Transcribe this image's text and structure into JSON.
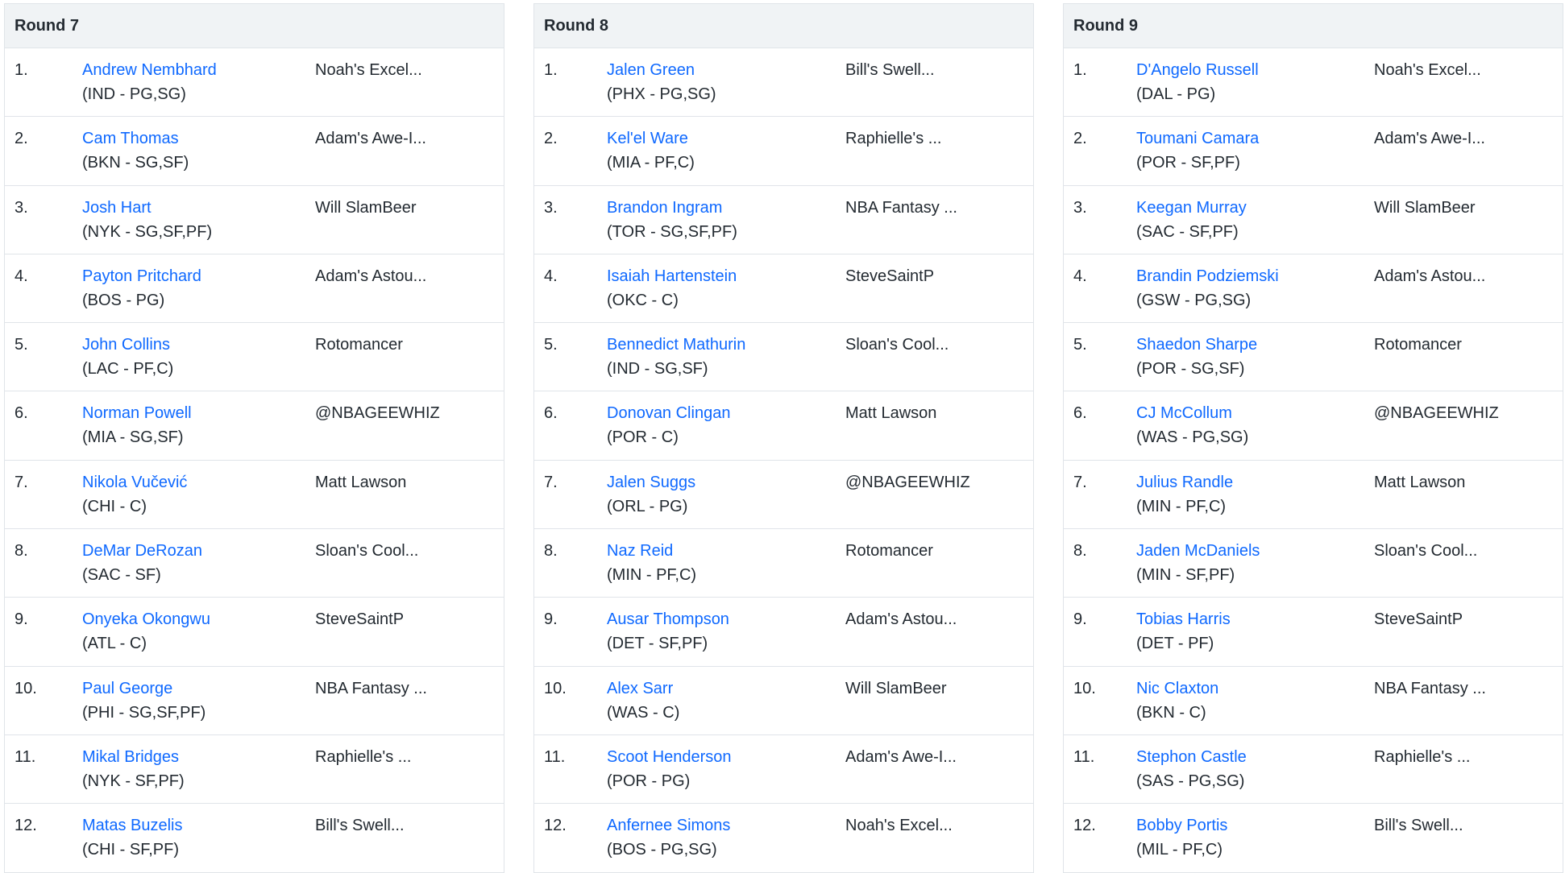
{
  "rounds": [
    {
      "title": "Round 7",
      "picks": [
        {
          "num": "1.",
          "player": "Andrew Nembhard",
          "meta": "(IND - PG,SG)",
          "team": "Noah's Excel..."
        },
        {
          "num": "2.",
          "player": "Cam Thomas",
          "meta": "(BKN - SG,SF)",
          "team": "Adam's Awe-I..."
        },
        {
          "num": "3.",
          "player": "Josh Hart",
          "meta": "(NYK - SG,SF,PF)",
          "team": "Will SlamBeer"
        },
        {
          "num": "4.",
          "player": "Payton Pritchard",
          "meta": "(BOS - PG)",
          "team": "Adam's Astou..."
        },
        {
          "num": "5.",
          "player": "John Collins",
          "meta": "(LAC - PF,C)",
          "team": "Rotomancer"
        },
        {
          "num": "6.",
          "player": "Norman Powell",
          "meta": "(MIA - SG,SF)",
          "team": "@NBAGEEWHIZ"
        },
        {
          "num": "7.",
          "player": "Nikola Vučević",
          "meta": "(CHI - C)",
          "team": "Matt Lawson"
        },
        {
          "num": "8.",
          "player": "DeMar DeRozan",
          "meta": "(SAC - SF)",
          "team": "Sloan's Cool..."
        },
        {
          "num": "9.",
          "player": "Onyeka Okongwu",
          "meta": "(ATL - C)",
          "team": "SteveSaintP"
        },
        {
          "num": "10.",
          "player": "Paul George",
          "meta": "(PHI - SG,SF,PF)",
          "team": "NBA Fantasy ..."
        },
        {
          "num": "11.",
          "player": "Mikal Bridges",
          "meta": "(NYK - SF,PF)",
          "team": "Raphielle's ..."
        },
        {
          "num": "12.",
          "player": "Matas Buzelis",
          "meta": "(CHI - SF,PF)",
          "team": "Bill's Swell..."
        }
      ]
    },
    {
      "title": "Round 8",
      "picks": [
        {
          "num": "1.",
          "player": "Jalen Green",
          "meta": "(PHX - PG,SG)",
          "team": "Bill's Swell..."
        },
        {
          "num": "2.",
          "player": "Kel'el Ware",
          "meta": "(MIA - PF,C)",
          "team": "Raphielle's ..."
        },
        {
          "num": "3.",
          "player": "Brandon Ingram",
          "meta": "(TOR - SG,SF,PF)",
          "team": "NBA Fantasy ..."
        },
        {
          "num": "4.",
          "player": "Isaiah Hartenstein",
          "meta": "(OKC - C)",
          "team": "SteveSaintP"
        },
        {
          "num": "5.",
          "player": "Bennedict Mathurin",
          "meta": "(IND - SG,SF)",
          "team": "Sloan's Cool..."
        },
        {
          "num": "6.",
          "player": "Donovan Clingan",
          "meta": "(POR - C)",
          "team": "Matt Lawson"
        },
        {
          "num": "7.",
          "player": "Jalen Suggs",
          "meta": "(ORL - PG)",
          "team": "@NBAGEEWHIZ"
        },
        {
          "num": "8.",
          "player": "Naz Reid",
          "meta": "(MIN - PF,C)",
          "team": "Rotomancer"
        },
        {
          "num": "9.",
          "player": "Ausar Thompson",
          "meta": "(DET - SF,PF)",
          "team": "Adam's Astou..."
        },
        {
          "num": "10.",
          "player": "Alex Sarr",
          "meta": "(WAS - C)",
          "team": "Will SlamBeer"
        },
        {
          "num": "11.",
          "player": "Scoot Henderson",
          "meta": "(POR - PG)",
          "team": "Adam's Awe-I..."
        },
        {
          "num": "12.",
          "player": "Anfernee Simons",
          "meta": "(BOS - PG,SG)",
          "team": "Noah's Excel..."
        }
      ]
    },
    {
      "title": "Round 9",
      "picks": [
        {
          "num": "1.",
          "player": "D'Angelo Russell",
          "meta": "(DAL - PG)",
          "team": "Noah's Excel..."
        },
        {
          "num": "2.",
          "player": "Toumani Camara",
          "meta": "(POR - SF,PF)",
          "team": "Adam's Awe-I..."
        },
        {
          "num": "3.",
          "player": "Keegan Murray",
          "meta": "(SAC - SF,PF)",
          "team": "Will SlamBeer"
        },
        {
          "num": "4.",
          "player": "Brandin Podziemski",
          "meta": "(GSW - PG,SG)",
          "team": "Adam's Astou..."
        },
        {
          "num": "5.",
          "player": "Shaedon Sharpe",
          "meta": "(POR - SG,SF)",
          "team": "Rotomancer"
        },
        {
          "num": "6.",
          "player": "CJ McCollum",
          "meta": "(WAS - PG,SG)",
          "team": "@NBAGEEWHIZ"
        },
        {
          "num": "7.",
          "player": "Julius Randle",
          "meta": "(MIN - PF,C)",
          "team": "Matt Lawson"
        },
        {
          "num": "8.",
          "player": "Jaden McDaniels",
          "meta": "(MIN - SF,PF)",
          "team": "Sloan's Cool..."
        },
        {
          "num": "9.",
          "player": "Tobias Harris",
          "meta": "(DET - PF)",
          "team": "SteveSaintP"
        },
        {
          "num": "10.",
          "player": "Nic Claxton",
          "meta": "(BKN - C)",
          "team": "NBA Fantasy ..."
        },
        {
          "num": "11.",
          "player": "Stephon Castle",
          "meta": "(SAS - PG,SG)",
          "team": "Raphielle's ..."
        },
        {
          "num": "12.",
          "player": "Bobby Portis",
          "meta": "(MIL - PF,C)",
          "team": "Bill's Swell..."
        }
      ]
    }
  ],
  "colors": {
    "link": "#0f69ff",
    "text": "#232a31",
    "header_bg": "#f0f3f5",
    "border": "#e0e4e9"
  }
}
